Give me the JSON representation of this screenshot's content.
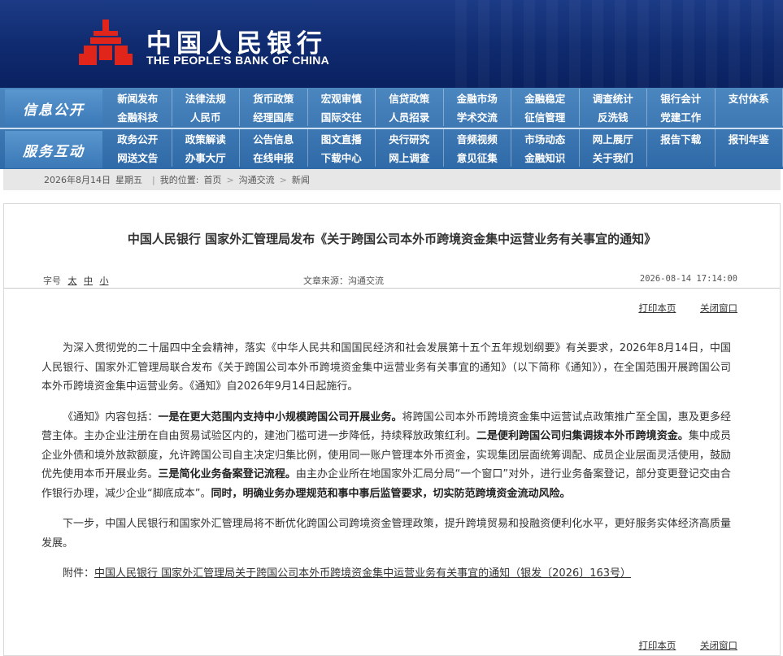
{
  "header": {
    "logo_cn": "中国人民银行",
    "logo_en": "THE PEOPLE'S BANK OF CHINA",
    "brand_color": "#0f2a6e",
    "logo_color": "#e1251b"
  },
  "nav": {
    "section1_label": "信息公开",
    "section2_label": "服务互动",
    "row1": [
      "新闻发布",
      "法律法规",
      "货币政策",
      "宏观审慎",
      "信贷政策",
      "金融市场",
      "金融稳定",
      "调查统计",
      "银行会计",
      "支付体系"
    ],
    "row2": [
      "金融科技",
      "人民币",
      "经理国库",
      "国际交往",
      "人员招录",
      "学术交流",
      "征信管理",
      "反洗钱",
      "党建工作",
      ""
    ],
    "row3": [
      "政务公开",
      "政策解读",
      "公告信息",
      "图文直播",
      "央行研究",
      "音频视频",
      "市场动态",
      "网上展厅",
      "报告下载",
      "报刊年鉴"
    ],
    "row4": [
      "网送文告",
      "办事大厅",
      "在线申报",
      "下载中心",
      "网上调查",
      "意见征集",
      "金融知识",
      "关于我们",
      "",
      ""
    ]
  },
  "breadcrumb": {
    "date": "2026年8月14日",
    "weekday": "星期五",
    "location_label": "我的位置:",
    "home": "首页",
    "level1": "沟通交流",
    "level2": "新闻"
  },
  "article": {
    "title": "中国人民银行 国家外汇管理局发布《关于跨国公司本外币跨境资金集中运营业务有关事宜的通知》",
    "font_size_label": "字号",
    "size_large": "太",
    "size_medium": "中",
    "size_small": "小",
    "source": "文章来源：沟通交流",
    "datetime": "2026-08-14 17:14:00",
    "print_label": "打印本页",
    "close_label": "关闭窗口",
    "p1": "为深入贯彻党的二十届四中全会精神，落实《中华人民共和国国民经济和社会发展第十五个五年规划纲要》有关要求，2026年8月14日，中国人民银行、国家外汇管理局联合发布《关于跨国公司本外币跨境资金集中运营业务有关事宜的通知》（以下简称《通知》），在全国范围开展跨国公司本外币跨境资金集中运营业务。《通知》自2026年9月14日起施行。",
    "p2_a": "《通知》内容包括：",
    "p2_b": "一是在更大范围内支持中小规模跨国公司开展业务。",
    "p2_c": "将跨国公司本外币跨境资金集中运营试点政策推广至全国，惠及更多经营主体。主办企业注册在自由贸易试验区内的，建池门槛可进一步降低，持续释放政策红利。",
    "p2_d": "二是便利跨国公司归集调拨本外币跨境资金。",
    "p2_e": "集中成员企业外债和境外放款额度，允许跨国公司自主决定归集比例，使用同一账户管理本外币资金，实现集团层面统筹调配、成员企业层面灵活使用，鼓励优先使用本币开展业务。",
    "p2_f": "三是简化业务备案登记流程。",
    "p2_g": "由主办企业所在地国家外汇局分局“一个窗口”对外，进行业务备案登记，部分变更登记交由合作银行办理，减少企业“脚底成本”。",
    "p2_h": "同时，明确业务办理规范和事中事后监管要求，切实防范跨境资金流动风险。",
    "p3": "下一步，中国人民银行和国家外汇管理局将不断优化跨国公司跨境资金管理政策，提升跨境贸易和投融资便利化水平，更好服务实体经济高质量发展。",
    "attach_label": "附件：",
    "attach_link": "中国人民银行 国家外汇管理局关于跨国公司本外币跨境资金集中运营业务有关事宜的通知（银发〔2026〕163号）"
  }
}
